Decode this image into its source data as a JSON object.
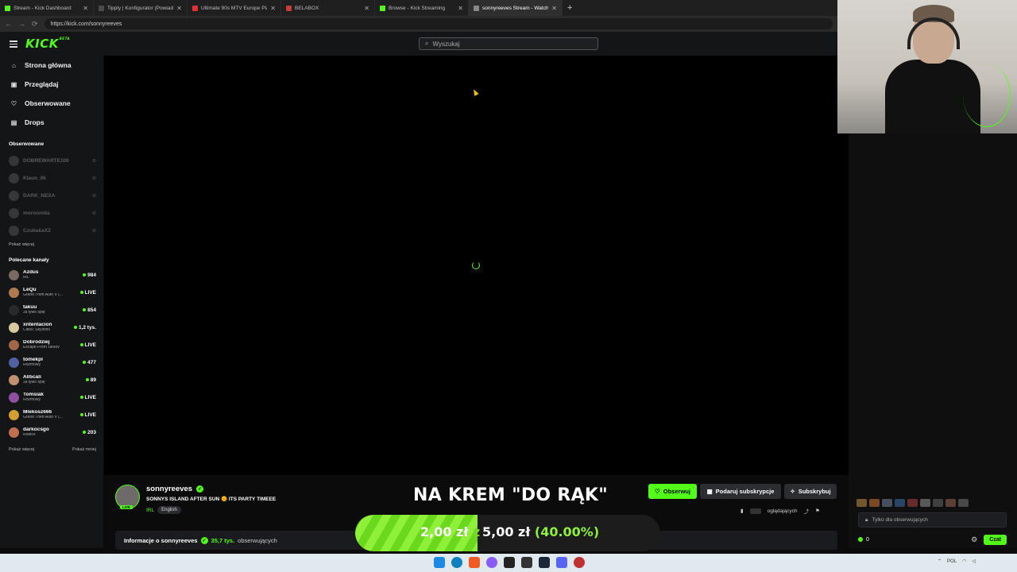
{
  "browser": {
    "tabs": [
      {
        "title": "Stream - Kick Dashboard",
        "color": "#53fc18"
      },
      {
        "title": "Tipply | Konfigurator (Powiadomi…",
        "color": "#4a4a4a"
      },
      {
        "title": "Ultimate 90s MTV Europe Playlist",
        "color": "#e03030"
      },
      {
        "title": "BELABOX",
        "color": "#c83c3c"
      },
      {
        "title": "Browse - Kick Streaming",
        "color": "#53fc18"
      },
      {
        "title": "sonnyreeves Stream - Watch Live …",
        "color": "#888888"
      }
    ],
    "new_tab": "+",
    "url": "https://kick.com/sonnyreeves"
  },
  "header": {
    "logo": "KICK",
    "logo_sup": "BETA",
    "search_placeholder": "Wyszukaj"
  },
  "sidebar": {
    "nav": [
      {
        "label": "Strona główna",
        "icon": "home-icon",
        "glyph": "⌂"
      },
      {
        "label": "Przeglądaj",
        "icon": "browse-icon",
        "glyph": "▣"
      },
      {
        "label": "Obserwowane",
        "icon": "heart-icon",
        "glyph": "♡"
      },
      {
        "label": "Drops",
        "icon": "drops-icon",
        "glyph": "▤"
      }
    ],
    "followed_title": "Obserwowane",
    "followed": [
      {
        "name": "DOBREWARTE100"
      },
      {
        "name": "Klaun_0k"
      },
      {
        "name": "DARK_NESA"
      },
      {
        "name": "moroonida"
      },
      {
        "name": "CzubakaXZ"
      }
    ],
    "followed_more": "Pokaż więcej",
    "recommended_title": "Polecane kanały",
    "recommended": [
      {
        "name": "Azdus",
        "category": "IRL",
        "viewers": "984",
        "color": "#7a6a60"
      },
      {
        "name": "LeQu",
        "category": "Grand Theft Auto V (...",
        "viewers": "LIVE",
        "color": "#b07a50"
      },
      {
        "name": "takuu",
        "category": "Ja tylko śpię",
        "viewers": "854",
        "color": "#2a2a2a"
      },
      {
        "name": "xntentacion",
        "category": "Cities: Skylines",
        "viewers": "1,2 tys.",
        "color": "#d8c8a0"
      },
      {
        "name": "Dobrodziej",
        "category": "Escape From Tarkov",
        "viewers": "LIVE",
        "color": "#a06848"
      },
      {
        "name": "tomekpl",
        "category": "Rozmowy",
        "viewers": "477",
        "color": "#5060a0"
      },
      {
        "name": "Ali5cali",
        "category": "Ja tylko śpię",
        "viewers": "89",
        "color": "#c09070"
      },
      {
        "name": "Tomsiak",
        "category": "Rozmowy",
        "viewers": "LIVE",
        "color": "#9050a0"
      },
      {
        "name": "Mlekosz666",
        "category": "Grand Theft Auto V (...",
        "viewers": "LIVE",
        "color": "#d0a030"
      },
      {
        "name": "darkocsgo",
        "category": "Roblox",
        "viewers": "203",
        "color": "#c07050"
      }
    ],
    "rec_more": "Pokaż więcej",
    "rec_less": "Pokaż mniej"
  },
  "stream": {
    "streamer": "sonnyreeves",
    "live_badge": "LIVE",
    "title": "SONNYS ISLAND AFTER SUN 🌞 ITS PARTY TIMEEE",
    "category": "IRL",
    "language": "English",
    "overlay_text": "NA KREM \"DO RĄK\"",
    "follow_label": "Obserwuj",
    "gift_label": "Podaruj subskrypcje",
    "subscribe_label": "Subskrybuj",
    "viewers_label": "oglądających",
    "about_label": "Informacje o sonnyreeves",
    "followers_count": "35,7 tys.",
    "followers_label": "obserwujących"
  },
  "goal": {
    "current": "2,00 zł",
    "current_cut": "z",
    "target": "5,00 zł",
    "percent": "(40.00%)",
    "progress": 0.4
  },
  "chat": {
    "input_placeholder": "Tylko dla obserwujących",
    "points": "0",
    "chat_button": "Czat"
  },
  "taskbar": {
    "tray_lang": "POL"
  }
}
